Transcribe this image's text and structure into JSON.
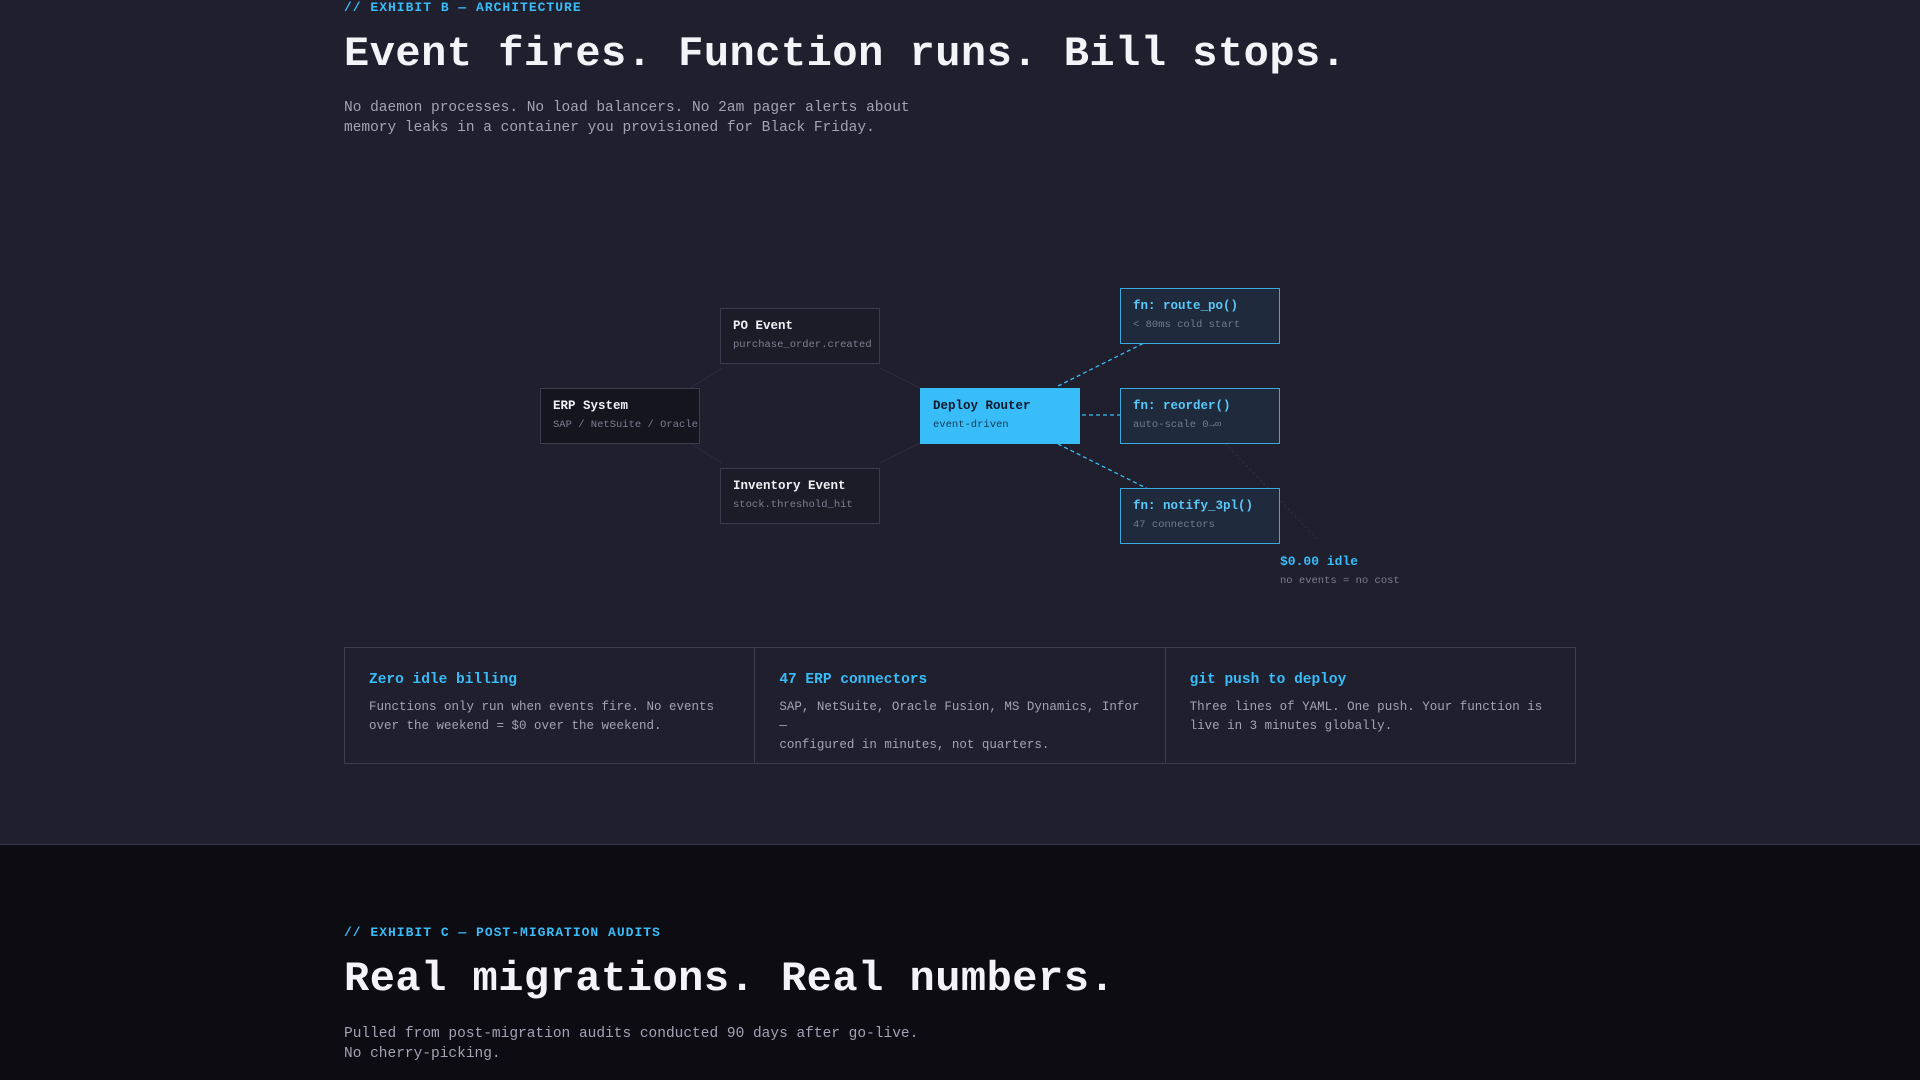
{
  "exhibit_b": {
    "eyebrow": "// EXHIBIT B — ARCHITECTURE",
    "title": "Event fires. Function runs. Bill stops.",
    "lead_line1": "No daemon processes. No load balancers. No 2am pager alerts about",
    "lead_line2": "memory leaks in a container you provisioned for Black Friday."
  },
  "diagram": {
    "erp": {
      "title": "ERP System",
      "sub": "SAP / NetSuite / Oracle"
    },
    "po_event": {
      "title": "PO Event",
      "sub": "purchase_order.created"
    },
    "inventory_event": {
      "title": "Inventory Event",
      "sub": "stock.threshold_hit"
    },
    "router": {
      "title": "Deploy Router",
      "sub": "event-driven"
    },
    "fn_route": {
      "title": "fn: route_po()",
      "sub": "< 80ms cold start"
    },
    "fn_reorder": {
      "title": "fn: reorder()",
      "sub": "auto-scale 0→∞"
    },
    "fn_notify": {
      "title": "fn: notify_3pl()",
      "sub": "47 connectors"
    },
    "idle": {
      "title": "$0.00 idle",
      "sub": "no events = no cost"
    },
    "colors": {
      "accent": "#38bdf8",
      "fn_border": "#3aa8e0"
    }
  },
  "features": [
    {
      "title": "Zero idle billing",
      "line1": "Functions only run when events fire. No events",
      "line2": "over the weekend = $0 over the weekend."
    },
    {
      "title": "47 ERP connectors",
      "line1": "SAP, NetSuite, Oracle Fusion, MS Dynamics, Infor —",
      "line2": "configured in minutes, not quarters."
    },
    {
      "title": "git push to deploy",
      "line1": "Three lines of YAML. One push. Your function is",
      "line2": "live in 3 minutes globally."
    }
  ],
  "exhibit_c": {
    "eyebrow": "// EXHIBIT C — POST-MIGRATION AUDITS",
    "title": "Real migrations. Real numbers.",
    "lead_line1": "Pulled from post-migration audits conducted 90 days after go-live.",
    "lead_line2": "No cherry-picking."
  }
}
